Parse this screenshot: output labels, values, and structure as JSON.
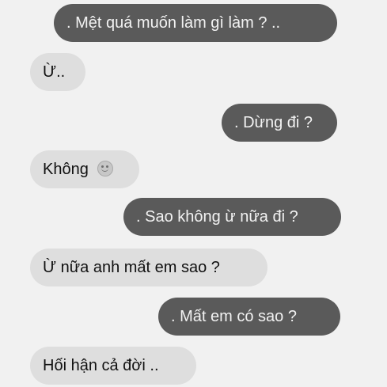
{
  "messages": [
    {
      "side": "sent",
      "text": ". Mệt quá muốn làm gì làm ? .."
    },
    {
      "side": "recv",
      "text": "Ừ.."
    },
    {
      "side": "sent",
      "text": ". Dừng đi ?"
    },
    {
      "side": "recv",
      "text": "Không",
      "icon": "smiley-emoji-icon"
    },
    {
      "side": "sent",
      "text": ". Sao không ừ nữa đi ?"
    },
    {
      "side": "recv",
      "text": "Ừ nữa anh mất em sao ?"
    },
    {
      "side": "sent",
      "text": ". Mất em có sao ?"
    },
    {
      "side": "recv",
      "text": "Hối hận cả đời .."
    }
  ],
  "colors": {
    "background": "#f1f1f1",
    "sent_bubble": "#5a5a5a",
    "sent_text": "#f2f2f2",
    "received_bubble": "#dedede",
    "received_text": "#111111"
  }
}
